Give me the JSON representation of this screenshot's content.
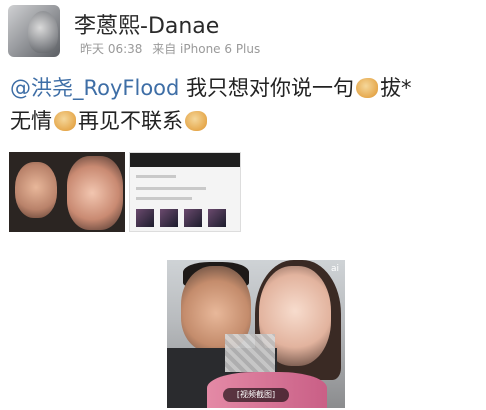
{
  "post": {
    "username": "李蒽熙-Danae",
    "meta": {
      "time": "昨天 06:38",
      "source": "来自 iPhone 6 Plus"
    },
    "content": {
      "mention": "@洪尧_RoyFlood",
      "text_1": " 我只想对你说一句",
      "emoji_1": "dislike-thumb-emoji",
      "text_2": "拔*",
      "text_3": "无情",
      "emoji_2": "handshake-emoji",
      "text_4": "再见不联系",
      "emoji_3": "pray-emoji"
    },
    "thumbnails": [
      {
        "name": "couple-closeup"
      },
      {
        "name": "chat-screenshot"
      }
    ]
  },
  "photo": {
    "badge": "ai",
    "caption": "[视频截图]"
  }
}
